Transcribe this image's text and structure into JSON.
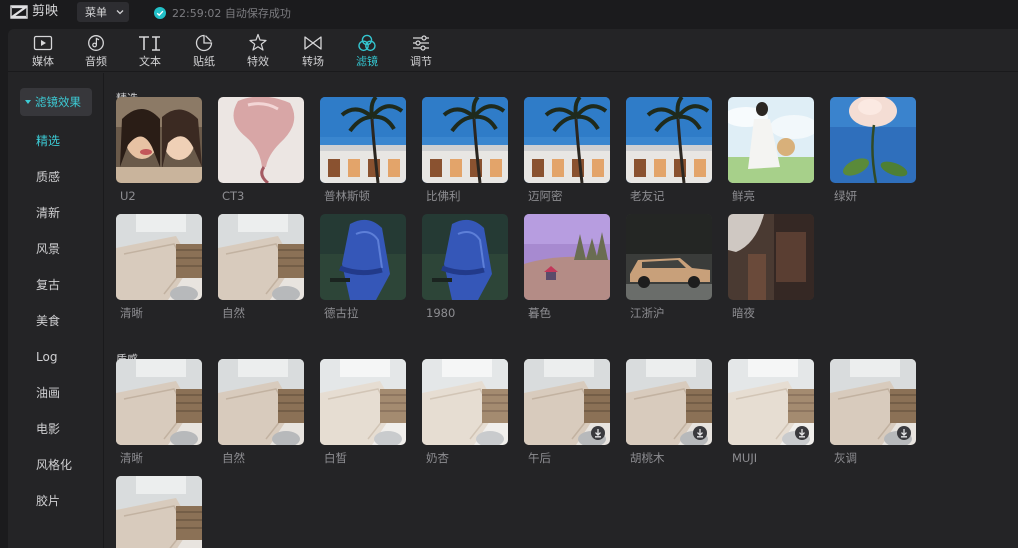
{
  "app": {
    "name": "剪映",
    "menu_label": "菜单",
    "save_status": "22:59:02 自动保存成功"
  },
  "toolbar": {
    "active": "滤镜",
    "items": [
      {
        "label": "媒体",
        "icon": "media-icon"
      },
      {
        "label": "音频",
        "icon": "audio-icon"
      },
      {
        "label": "文本",
        "icon": "text-icon"
      },
      {
        "label": "贴纸",
        "icon": "sticker-icon"
      },
      {
        "label": "特效",
        "icon": "effects-icon"
      },
      {
        "label": "转场",
        "icon": "transition-icon"
      },
      {
        "label": "滤镜",
        "icon": "filter-icon"
      },
      {
        "label": "调节",
        "icon": "adjust-icon"
      }
    ]
  },
  "sidebar": {
    "header": "滤镜效果",
    "active": "精选",
    "items": [
      "精选",
      "质感",
      "清新",
      "风景",
      "复古",
      "美食",
      "Log",
      "油画",
      "电影",
      "风格化",
      "胶片"
    ]
  },
  "sections": [
    {
      "title": "精选",
      "filters": [
        {
          "name": "U2",
          "thumb": "girls",
          "download": false
        },
        {
          "name": "CT3",
          "thumb": "balloon",
          "download": false
        },
        {
          "name": "普林斯顿",
          "thumb": "palm",
          "download": false
        },
        {
          "name": "比佛利",
          "thumb": "palm",
          "download": false
        },
        {
          "name": "迈阿密",
          "thumb": "palm",
          "download": false
        },
        {
          "name": "老友记",
          "thumb": "palm",
          "download": false
        },
        {
          "name": "鲜亮",
          "thumb": "woman",
          "download": false
        },
        {
          "name": "绿妍",
          "thumb": "flower",
          "download": false
        },
        {
          "name": "清晰",
          "thumb": "cloth",
          "download": false
        },
        {
          "name": "自然",
          "thumb": "cloth",
          "download": false
        },
        {
          "name": "德古拉",
          "thumb": "man",
          "download": false
        },
        {
          "name": "1980",
          "thumb": "man",
          "download": false
        },
        {
          "name": "暮色",
          "thumb": "hill",
          "download": false
        },
        {
          "name": "江浙沪",
          "thumb": "car",
          "download": false
        },
        {
          "name": "暗夜",
          "thumb": "dark",
          "download": false
        }
      ]
    },
    {
      "title": "质感",
      "filters": [
        {
          "name": "清晰",
          "thumb": "cloth",
          "download": false
        },
        {
          "name": "自然",
          "thumb": "cloth",
          "download": false
        },
        {
          "name": "白皙",
          "thumb": "cloth-light",
          "download": false
        },
        {
          "name": "奶杏",
          "thumb": "cloth-light",
          "download": false
        },
        {
          "name": "午后",
          "thumb": "cloth",
          "download": true
        },
        {
          "name": "胡桃木",
          "thumb": "cloth",
          "download": true
        },
        {
          "name": "MUJI",
          "thumb": "cloth-light",
          "download": true
        },
        {
          "name": "灰调",
          "thumb": "cloth",
          "download": true
        },
        {
          "name": "",
          "thumb": "cloth",
          "download": false
        }
      ]
    }
  ],
  "colors": {
    "accent": "#34c6d0",
    "background": "#1b1b1d",
    "panel": "#242426"
  }
}
